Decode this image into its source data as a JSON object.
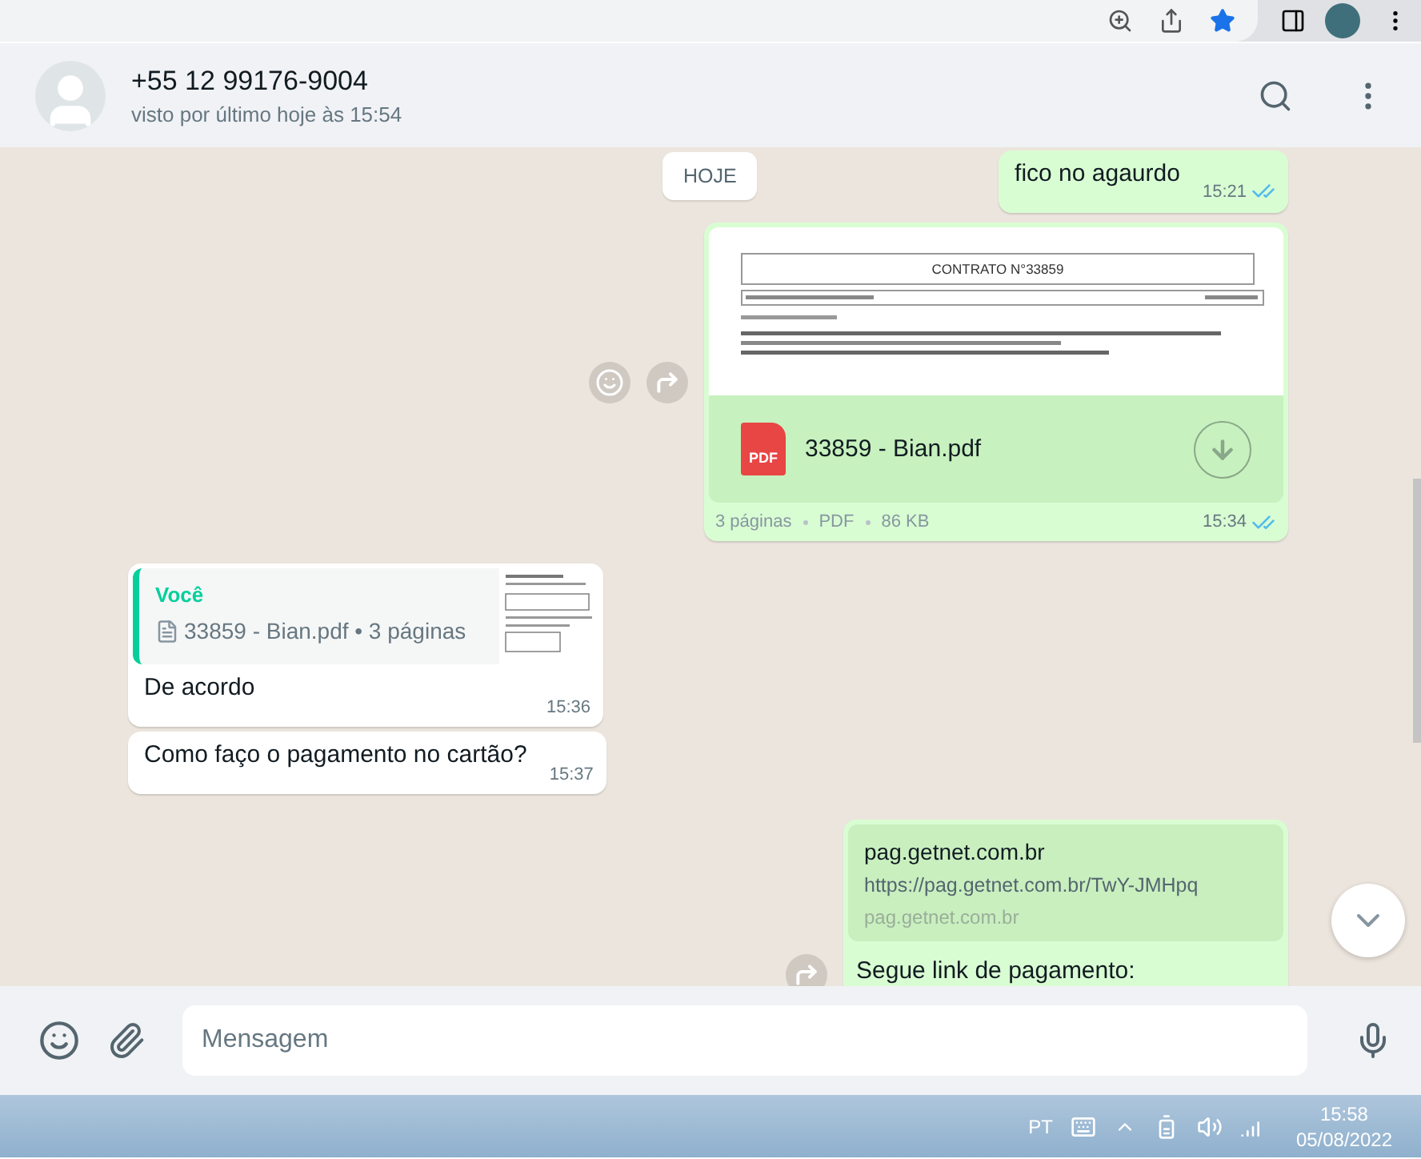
{
  "contact": {
    "name": "+55 12 99176-9004",
    "status": "visto por último hoje às 15:54"
  },
  "date_chip": "HOJE",
  "messages": [
    {
      "kind": "text",
      "sent": true,
      "text": "fico no agaurdo",
      "time": "15:21",
      "read": true
    },
    {
      "kind": "document",
      "sent": true,
      "preview_title": "CONTRATO N°33859",
      "file_icon_label": "PDF",
      "file_name": "33859 - Bian.pdf",
      "meta": [
        "3 páginas",
        "PDF",
        "86 KB"
      ],
      "time": "15:34",
      "read": true
    },
    {
      "kind": "reply",
      "sent": false,
      "quote_author": "Você",
      "quote_text": "33859 - Bian.pdf • 3 páginas",
      "text": "De acordo",
      "time": "15:36"
    },
    {
      "kind": "text",
      "sent": false,
      "text": "Como faço o pagamento no cartão?",
      "time": "15:37"
    },
    {
      "kind": "link",
      "sent": true,
      "link_title": "pag.getnet.com.br",
      "link_url": "https://pag.getnet.com.br/TwY-JMHpq",
      "link_domain": "pag.getnet.com.br",
      "text": "Segue link de pagamento:"
    }
  ],
  "composer": {
    "placeholder": "Mensagem"
  },
  "taskbar": {
    "language": "PT",
    "time": "15:58",
    "date": "05/08/2022"
  }
}
